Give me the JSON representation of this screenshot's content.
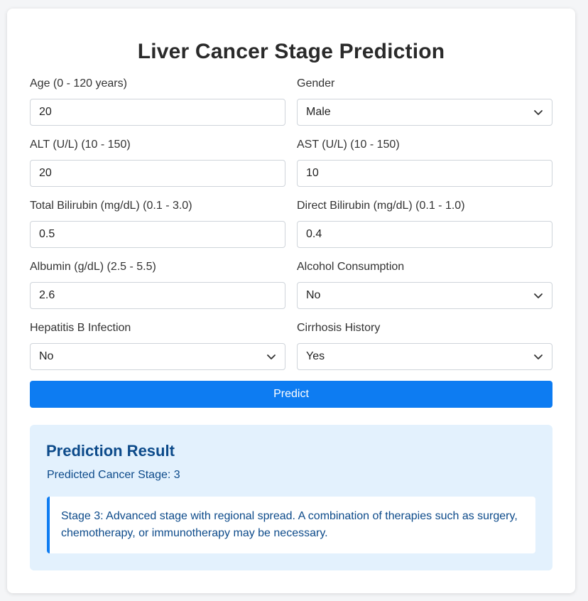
{
  "title": "Liver Cancer Stage Prediction",
  "fields": [
    {
      "label": "Age (0 - 120 years)",
      "value": "20",
      "type": "input"
    },
    {
      "label": "Gender",
      "value": "Male",
      "type": "select"
    },
    {
      "label": "ALT (U/L) (10 - 150)",
      "value": "20",
      "type": "input"
    },
    {
      "label": "AST (U/L) (10 - 150)",
      "value": "10",
      "type": "input"
    },
    {
      "label": "Total Bilirubin (mg/dL) (0.1 - 3.0)",
      "value": "0.5",
      "type": "input"
    },
    {
      "label": "Direct Bilirubin (mg/dL) (0.1 - 1.0)",
      "value": "0.4",
      "type": "input"
    },
    {
      "label": "Albumin (g/dL) (2.5 - 5.5)",
      "value": "2.6",
      "type": "input"
    },
    {
      "label": "Alcohol Consumption",
      "value": "No",
      "type": "select"
    },
    {
      "label": "Hepatitis B Infection",
      "value": "No",
      "type": "select"
    },
    {
      "label": "Cirrhosis History",
      "value": "Yes",
      "type": "select"
    }
  ],
  "predict_button": "Predict",
  "result": {
    "heading": "Prediction Result",
    "stage_text": "Predicted Cancer Stage: 3",
    "description": "Stage 3: Advanced stage with regional spread. A combination of therapies such as surgery, chemotherapy, or immunotherapy may be necessary."
  },
  "colors": {
    "accent": "#0d7cf2",
    "result_bg": "#e3f1fd",
    "result_text": "#0c4a8a"
  },
  "icons": {
    "select_arrow": "chevron-down-icon"
  }
}
